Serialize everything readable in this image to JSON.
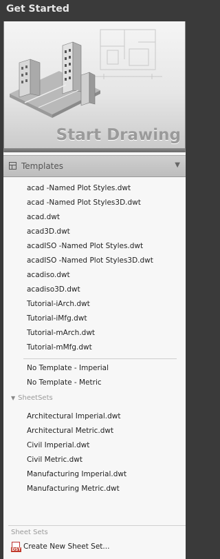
{
  "header": {
    "title": "Get Started"
  },
  "hero": {
    "title": "Start Drawing"
  },
  "templates": {
    "label": "Templates",
    "items": [
      "acad -Named Plot Styles.dwt",
      "acad -Named Plot Styles3D.dwt",
      "acad.dwt",
      "acad3D.dwt",
      "acadISO -Named Plot Styles.dwt",
      "acadISO -Named Plot Styles3D.dwt",
      "acadiso.dwt",
      "acadiso3D.dwt",
      "Tutorial-iArch.dwt",
      "Tutorial-iMfg.dwt",
      "Tutorial-mArch.dwt",
      "Tutorial-mMfg.dwt"
    ],
    "no_template": [
      "No Template - Imperial",
      "No Template - Metric"
    ]
  },
  "sheetsets": {
    "label": "SheetSets",
    "items": [
      "Architectural Imperial.dwt",
      "Architectural Metric.dwt",
      "Civil Imperial.dwt",
      "Civil Metric.dwt",
      "Manufacturing Imperial.dwt",
      "Manufacturing Metric.dwt"
    ]
  },
  "sheet_sets_footer": {
    "label": "Sheet Sets",
    "create_label": "Create New Sheet Set..."
  }
}
